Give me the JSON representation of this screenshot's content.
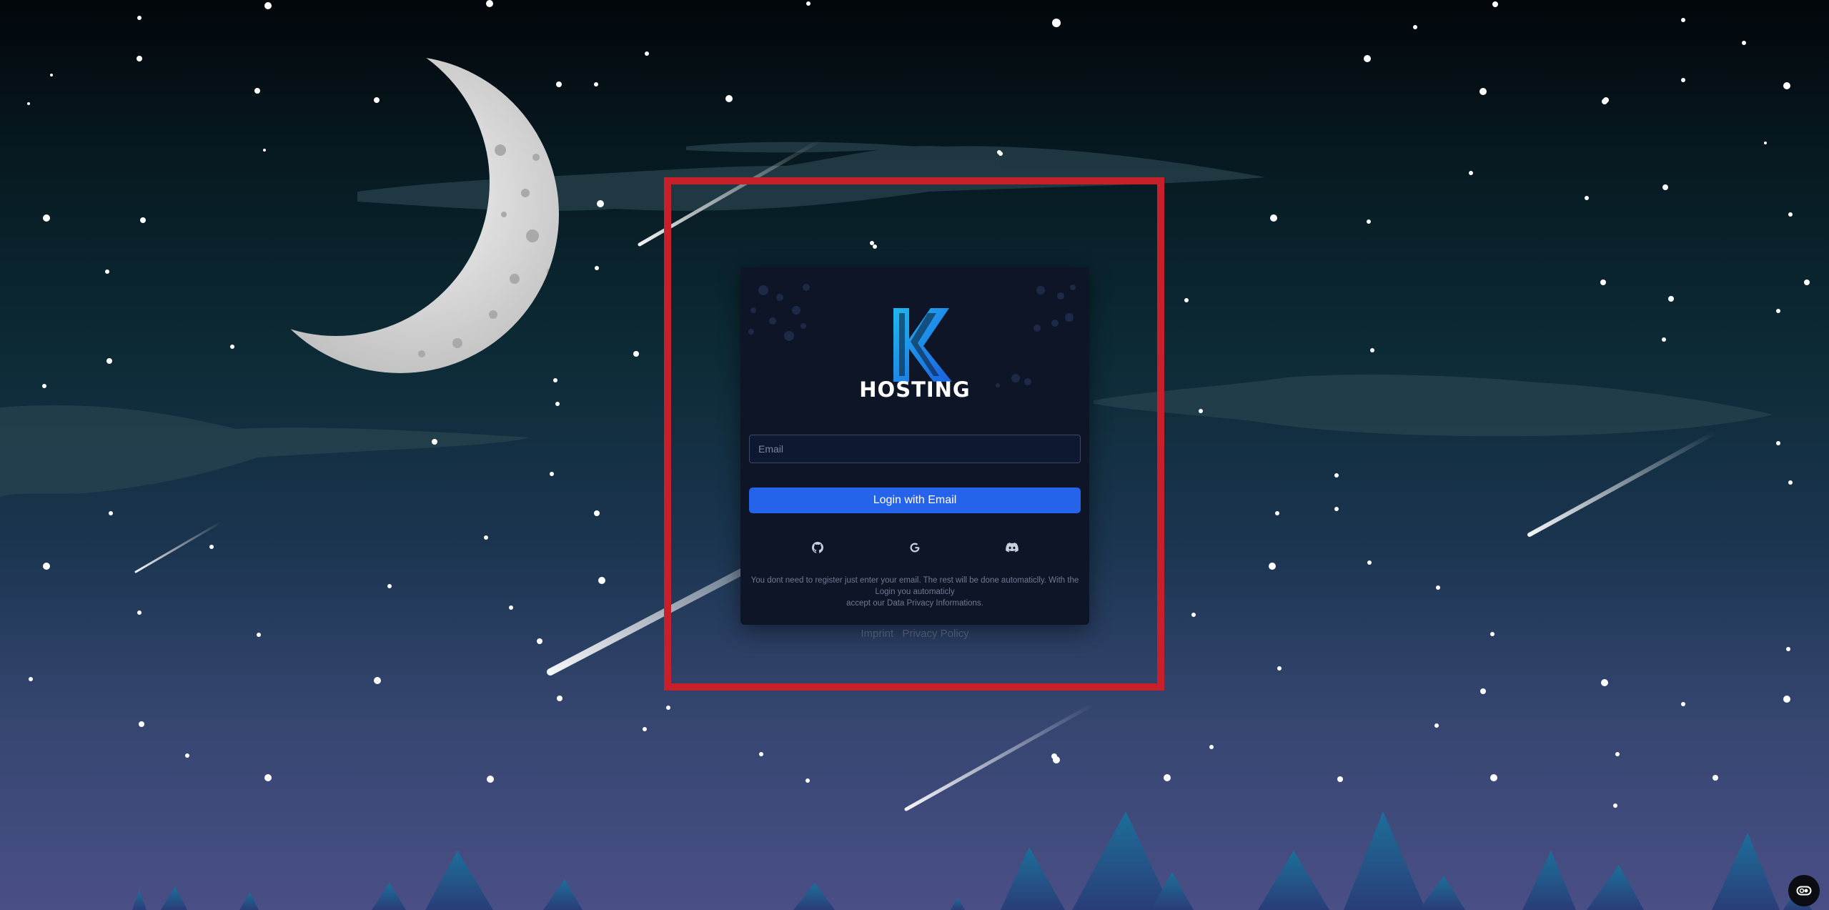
{
  "logo": {
    "icon": "k-hosting-logo",
    "text": "HOSTING"
  },
  "login": {
    "email_placeholder": "Email",
    "submit_label": "Login with Email"
  },
  "social": [
    {
      "icon": "github-icon"
    },
    {
      "icon": "google-icon"
    },
    {
      "icon": "discord-icon"
    }
  ],
  "notice": {
    "line1": "You dont need to register just enter your email. The rest will be done automaticlly. With the Login you automaticly",
    "line2": "accept our Data Privacy Informations."
  },
  "footer": {
    "imprint": "Imprint",
    "privacy": "Privacy Policy"
  },
  "colors": {
    "accent": "#2563eb",
    "card": "#0d1527",
    "highlight_box": "#c8202a",
    "logo_gradient": [
      "#1fb8f0",
      "#1a5fe0"
    ]
  },
  "corner_button": {
    "icon": "cookie-settings-icon"
  }
}
